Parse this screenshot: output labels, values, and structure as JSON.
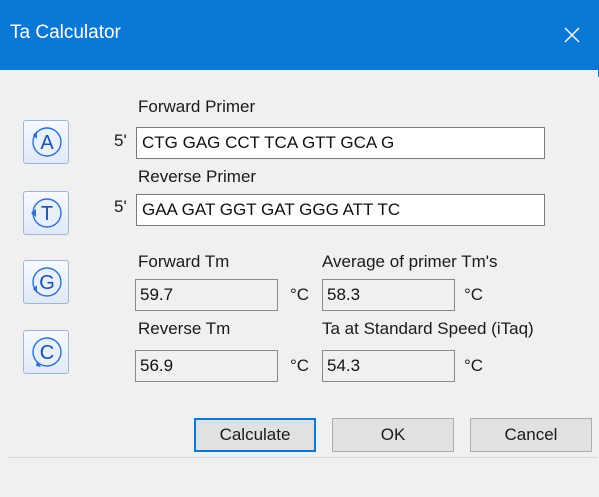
{
  "window": {
    "title": "Ta Calculator"
  },
  "bases": [
    {
      "letter": "A"
    },
    {
      "letter": "T"
    },
    {
      "letter": "G"
    },
    {
      "letter": "C"
    }
  ],
  "primers": {
    "five_prime_label": "5'",
    "forward_label": "Forward Primer",
    "forward_value": "CTG GAG CCT TCA GTT GCA G",
    "reverse_label": "Reverse Primer",
    "reverse_value": "GAA GAT GGT GAT GGG ATT TC"
  },
  "results": {
    "forward_tm_label": "Forward Tm",
    "forward_tm_value": "59.7",
    "reverse_tm_label": "Reverse Tm",
    "reverse_tm_value": "56.9",
    "avg_tm_label": "Average of primer Tm's",
    "avg_tm_value": "58.3",
    "ta_label": "Ta at Standard Speed (iTaq)",
    "ta_value": "54.3",
    "unit": "°C"
  },
  "buttons": {
    "calculate": "Calculate",
    "ok": "OK",
    "cancel": "Cancel"
  },
  "colors": {
    "titlebar": "#0a78d4",
    "accent": "#0a78d4",
    "background": "#f0f0f0"
  }
}
